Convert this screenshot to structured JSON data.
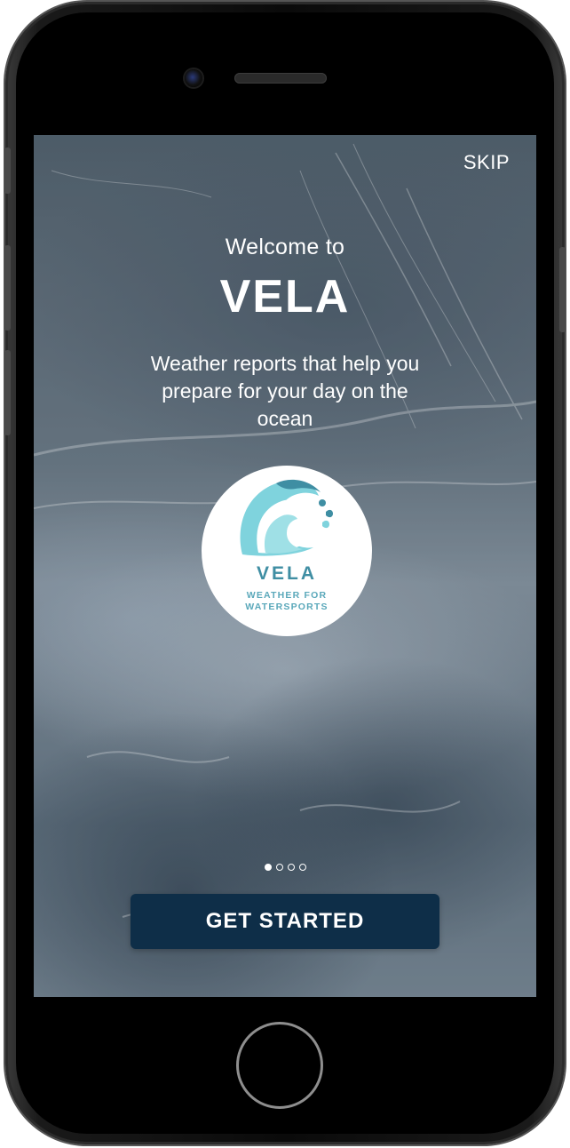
{
  "onboarding": {
    "skip_label": "SKIP",
    "welcome_text": "Welcome to",
    "app_name": "VELA",
    "tagline": "Weather reports that help you prepare for your day on the ocean",
    "logo": {
      "icon": "wave-icon",
      "name": "VELA",
      "subtitle_line1": "WEATHER FOR",
      "subtitle_line2": "WATERSPORTS"
    },
    "pager": {
      "total_pages": 4,
      "current_page": 1
    },
    "cta_label": "GET STARTED"
  },
  "colors": {
    "button_bg": "#0e2e48",
    "logo_teal": "#3f8ea3",
    "logo_wave_light": "#7fd3dd"
  }
}
